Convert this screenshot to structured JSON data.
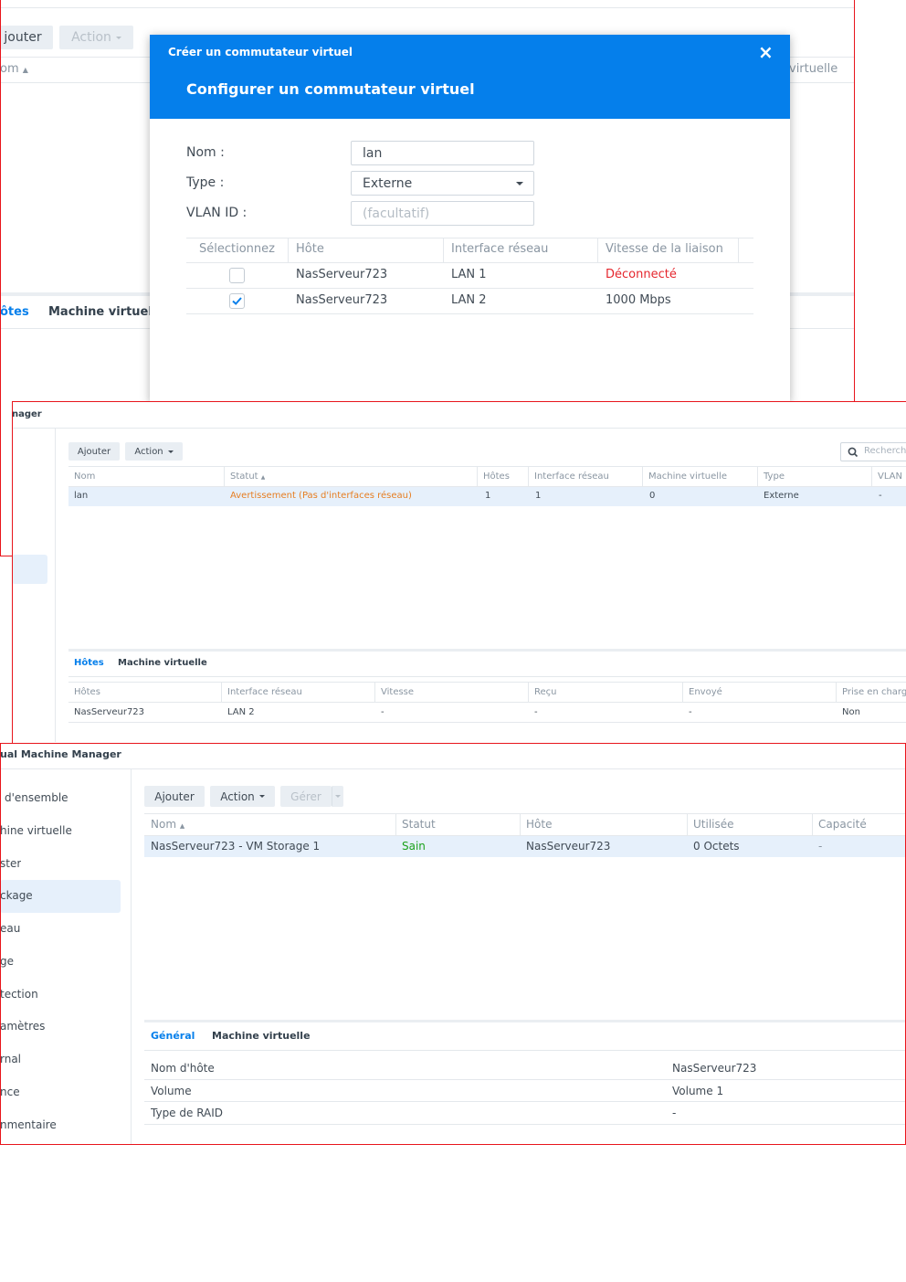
{
  "p1": {
    "toolbar": {
      "add": "jouter",
      "action": "Action"
    },
    "col_nom": "om",
    "col_virtuelle": "virtuelle",
    "tabs": {
      "hotes": "ôtes",
      "vm": "Machine virtuell"
    }
  },
  "dialog": {
    "title": "Créer un commutateur virtuel",
    "close": "×",
    "heading": "Configurer un commutateur virtuel",
    "fields": {
      "name_label": "Nom :",
      "name_value": "lan",
      "type_label": "Type :",
      "type_value": "Externe",
      "vlan_label": "VLAN ID :",
      "vlan_placeholder": "(facultatif)"
    },
    "columns": [
      "Sélectionnez",
      "Hôte",
      "Interface réseau",
      "Vitesse de la liaison"
    ],
    "rows": [
      {
        "selected": false,
        "host": "NasServeur723",
        "iface": "LAN 1",
        "speed": "Déconnecté",
        "speed_color": "#e5262d"
      },
      {
        "selected": true,
        "host": "NasServeur723",
        "iface": "LAN 2",
        "speed": "1000 Mbps",
        "speed_color": "#414b55"
      }
    ]
  },
  "p2": {
    "title": "nager",
    "toolbar": {
      "add": "Ajouter",
      "action": "Action",
      "search_placeholder": "Recherch"
    },
    "columns": [
      "Nom",
      "Statut",
      "Hôtes",
      "Interface réseau",
      "Machine virtuelle",
      "Type",
      "VLAN"
    ],
    "row": {
      "nom": "lan",
      "statut": "Avertissement (Pas d'interfaces réseau)",
      "hotes": "1",
      "iface": "1",
      "vm": "0",
      "type": "Externe",
      "vlan": "-"
    },
    "tabs": {
      "hotes": "Hôtes",
      "vm": "Machine virtuelle"
    },
    "bottom_columns": [
      "Hôtes",
      "Interface réseau",
      "Vitesse",
      "Reçu",
      "Envoyé",
      "Prise en charg"
    ],
    "bottom_row": [
      "NasServeur723",
      "LAN 2",
      "-",
      "-",
      "-",
      "Non"
    ]
  },
  "p3": {
    "title": "ual Machine Manager",
    "sidebar": [
      "d'ensemble",
      "hine virtuelle",
      "ster",
      "ckage",
      "eau",
      "ge",
      "tection",
      "amètres",
      "rnal",
      "nce",
      "nmentaire"
    ],
    "toolbar": {
      "add": "Ajouter",
      "action": "Action",
      "manage": "Gérer"
    },
    "columns": [
      "Nom",
      "Statut",
      "Hôte",
      "Utilisée",
      "Capacité"
    ],
    "row": {
      "nom": "NasServeur723 - VM Storage 1",
      "statut": "Sain",
      "hote": "NasServeur723",
      "utilisee": "0 Octets",
      "capacite": "-"
    },
    "tabs": {
      "general": "Général",
      "vm": "Machine virtuelle"
    },
    "details": [
      {
        "label": "Nom d'hôte",
        "value": "NasServeur723"
      },
      {
        "label": "Volume",
        "value": "Volume 1"
      },
      {
        "label": "Type de RAID",
        "value": "-"
      }
    ]
  },
  "colors": {
    "accent": "#057feb",
    "frame": "#e8151c",
    "warning": "#e67e22",
    "ok": "#1ca21c",
    "error": "#e5262d"
  }
}
